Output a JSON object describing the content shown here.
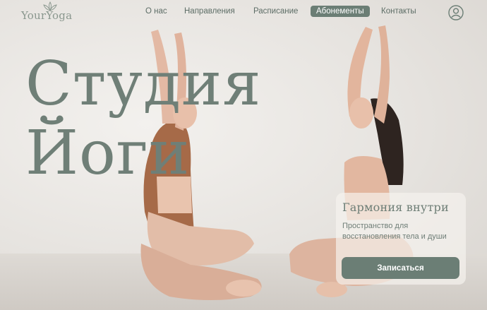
{
  "brand": {
    "logo_text": "YourYoga",
    "logo_icon": "lotus-icon"
  },
  "nav": {
    "items": [
      {
        "label": "О нас"
      },
      {
        "label": "Направления"
      },
      {
        "label": "Расписание"
      },
      {
        "label": "Абонементы",
        "active": true
      },
      {
        "label": "Контакты"
      }
    ],
    "account_icon": "user-icon"
  },
  "hero": {
    "title_line1": "Студия",
    "title_line2": "Йоги"
  },
  "card": {
    "title": "Гармония внутри",
    "text": "Пространство для восстановления тела и души",
    "button_label": "Записаться"
  },
  "colors": {
    "accent": "#6b7e75",
    "title": "#6f7f77",
    "background": "#e9e7e4"
  }
}
